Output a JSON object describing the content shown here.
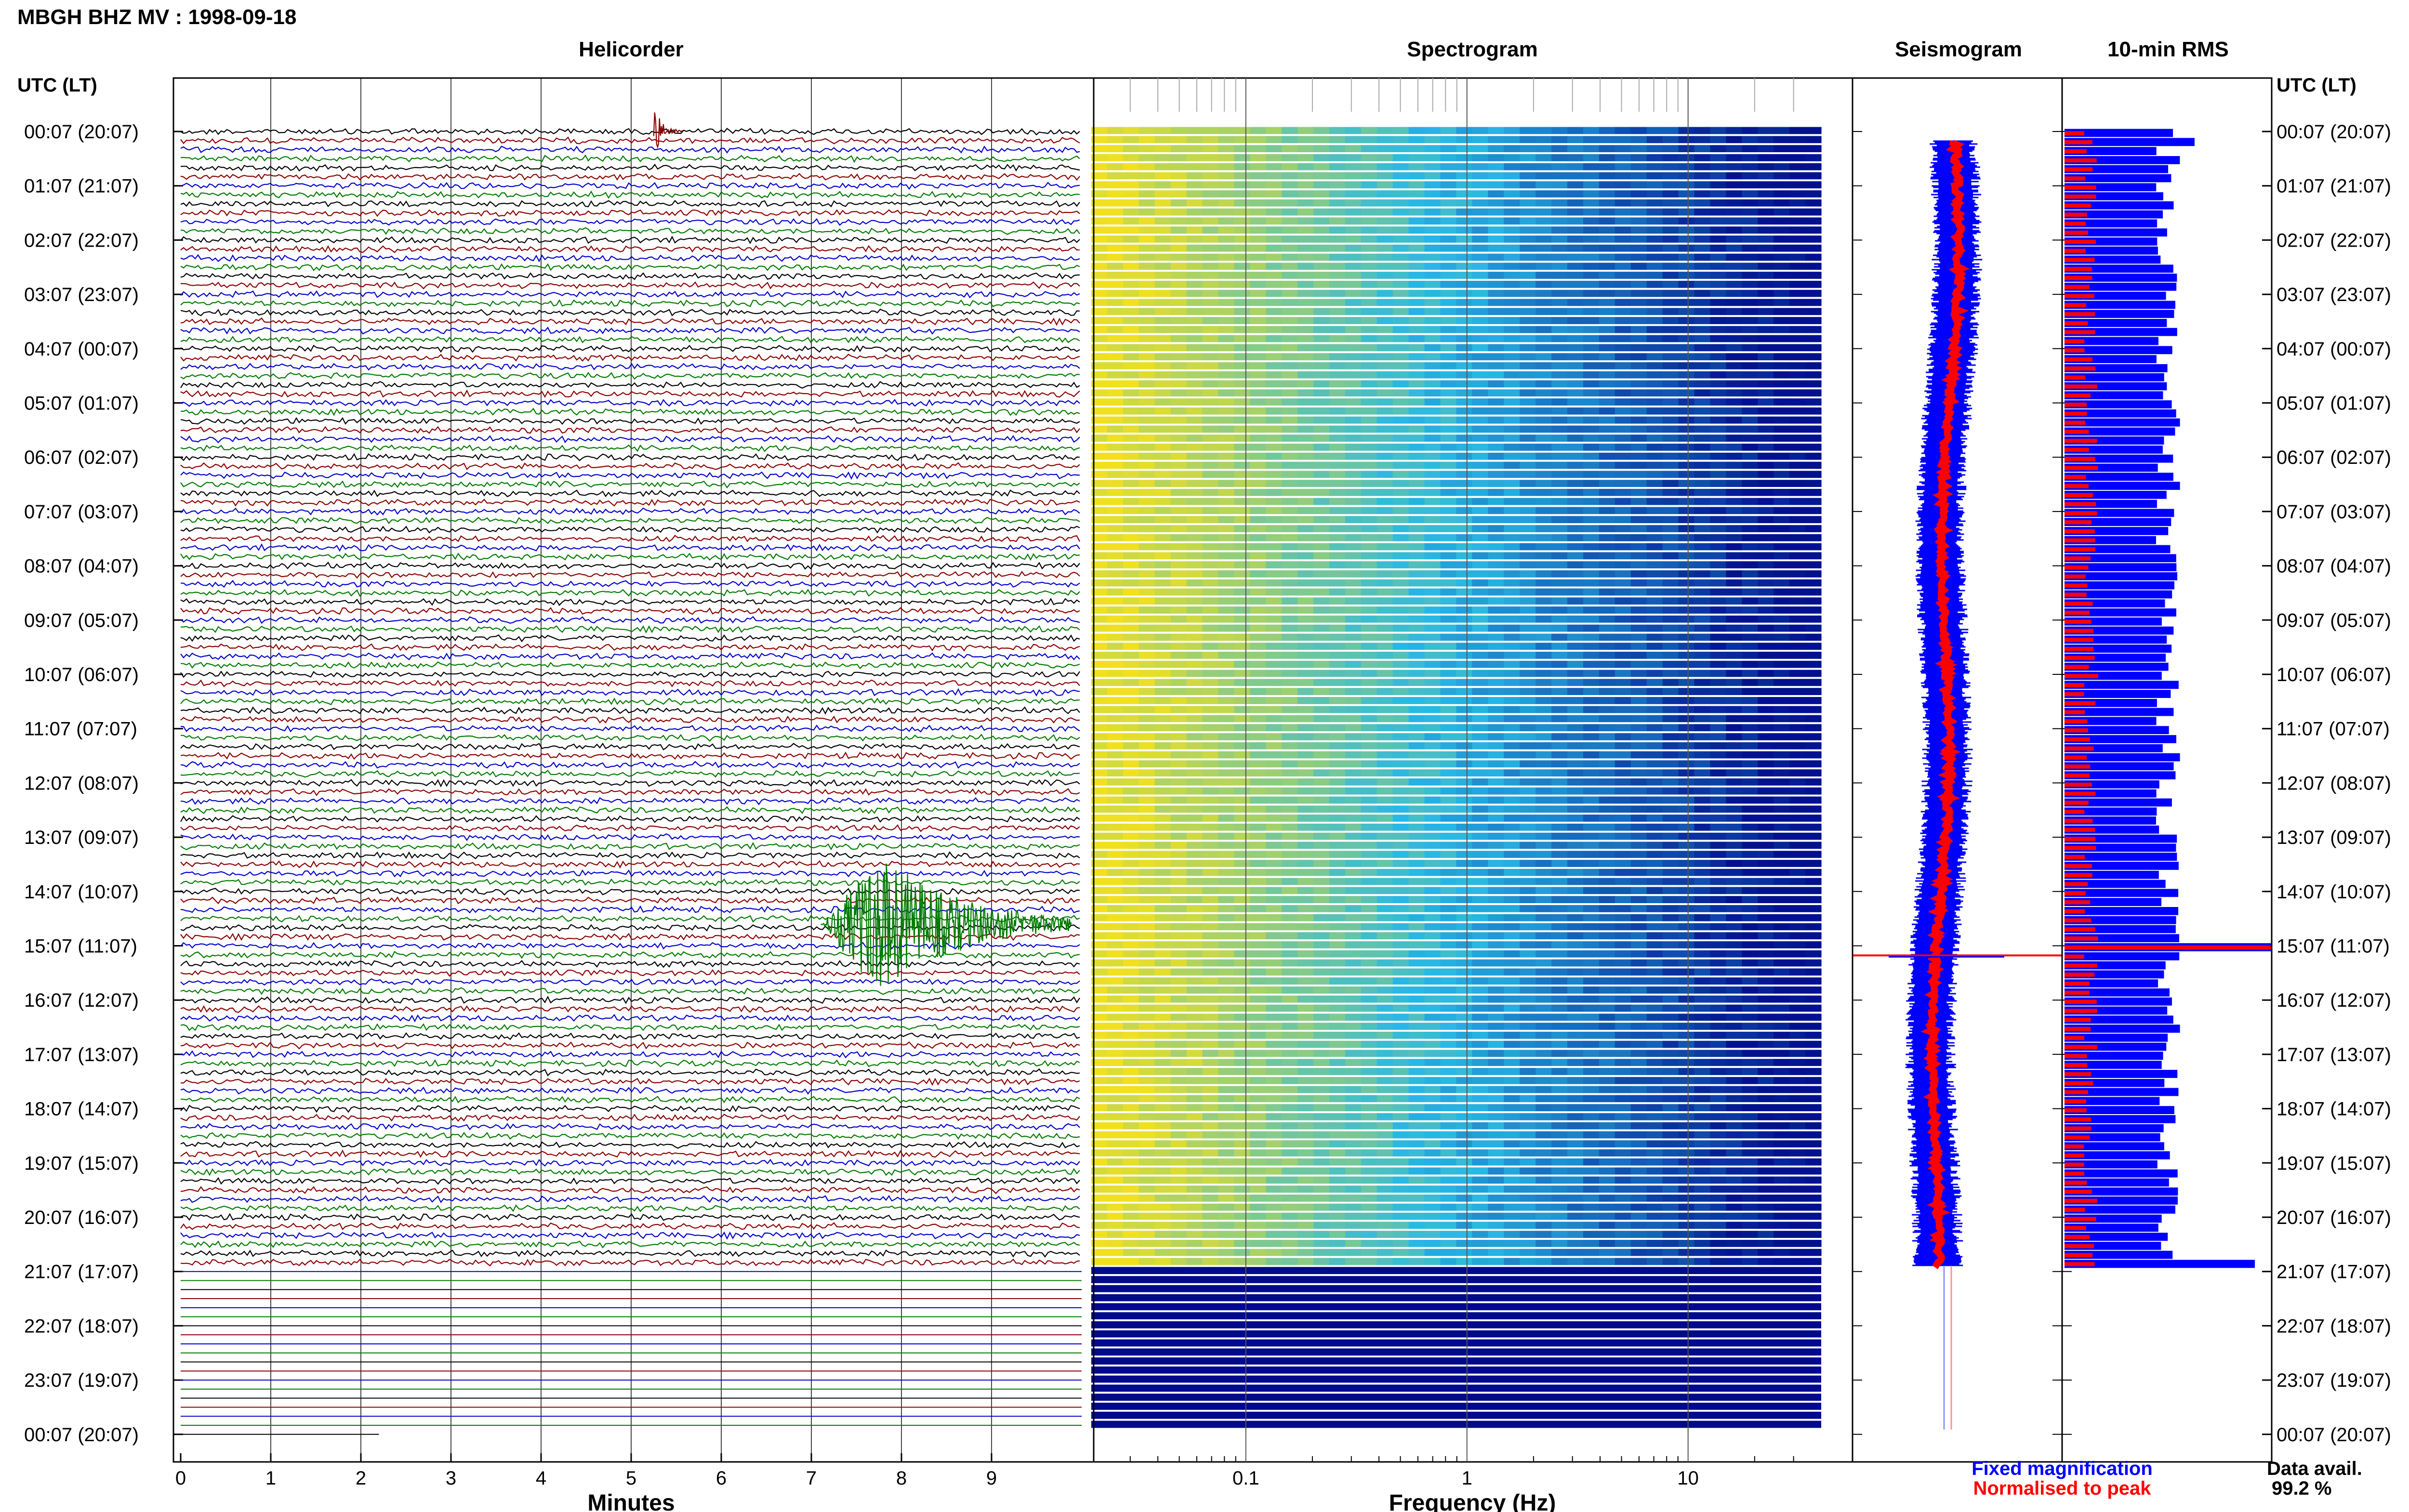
{
  "header": {
    "title": "MBGH BHZ MV : 1998-09-18",
    "panel_titles": [
      "Helicorder",
      "Spectrogram",
      "Seismogram",
      "10-min RMS"
    ],
    "left_axis_label": "UTC (LT)",
    "right_axis_label": "UTC (LT)"
  },
  "legend": {
    "fixed": "Fixed magnification",
    "normalised": "Normalised to peak",
    "fixed_color": "#0000ff",
    "normalised_color": "#ff0000"
  },
  "data_avail": {
    "label": "Data avail.",
    "value": "99.2 %"
  },
  "colors": {
    "trace_cycle": [
      "#000000",
      "#8b0000",
      "#0000cd",
      "#007a00"
    ],
    "spec_low": "#000a8c",
    "spec_mid": "#27b8e5",
    "spec_high": "#f0e020"
  },
  "chart_data": [
    {
      "type": "line",
      "name": "Helicorder",
      "xlabel": "Minutes",
      "xlim": [
        0,
        10
      ],
      "x_ticks": [
        "0",
        "1",
        "2",
        "3",
        "4",
        "5",
        "6",
        "7",
        "8",
        "9"
      ],
      "time_labels_utc_lt": [
        "00:07 (20:07)",
        "01:07 (21:07)",
        "02:07 (22:07)",
        "03:07 (23:07)",
        "04:07 (00:07)",
        "05:07 (01:07)",
        "06:07 (02:07)",
        "07:07 (03:07)",
        "08:07 (04:07)",
        "09:07 (05:07)",
        "10:07 (06:07)",
        "11:07 (07:07)",
        "12:07 (08:07)",
        "13:07 (09:07)",
        "14:07 (10:07)",
        "15:07 (11:07)",
        "16:07 (12:07)",
        "17:07 (13:07)",
        "18:07 (14:07)",
        "19:07 (15:07)",
        "20:07 (16:07)",
        "21:07 (17:07)",
        "22:07 (18:07)",
        "23:07 (19:07)",
        "00:07 (20:07)"
      ],
      "lines_per_hour": 6,
      "events": [
        {
          "hour_index": 0.0,
          "minute": 5.25,
          "amplitude": 2.5
        },
        {
          "hour_index": 14.6,
          "minute": 7.8,
          "amplitude": 4.0
        }
      ]
    },
    {
      "type": "heatmap",
      "name": "Spectrogram",
      "xlabel": "Frequency (Hz)",
      "x_scale": "log",
      "xlim": [
        0.02,
        40
      ],
      "x_ticks": [
        "0.1",
        "1",
        "10"
      ],
      "data_until_hour_index": 21.0
    },
    {
      "type": "line",
      "name": "Seismogram",
      "series": [
        {
          "name": "Fixed magnification"
        },
        {
          "name": "Normalised to peak"
        }
      ]
    },
    {
      "type": "bar",
      "name": "10-min RMS",
      "series": [
        {
          "name": "Fixed magnification"
        },
        {
          "name": "Normalised to peak"
        }
      ],
      "peak_hour_index": 15.0
    }
  ]
}
